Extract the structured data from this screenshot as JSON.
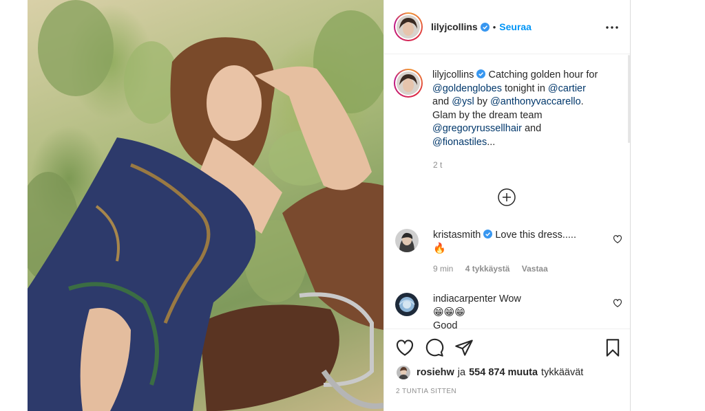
{
  "post": {
    "username": "lilyjcollins",
    "verified": true,
    "follow_separator": "•",
    "follow_label": "Seuraa",
    "more_icon": "more-horizontal-icon",
    "next_icon": "chevron-right-icon"
  },
  "caption": {
    "username": "lilyjcollins",
    "line1_a": "Catching golden hour for",
    "mention1": "@goldenglobes",
    "line2_b": " tonight in ",
    "mention2": "@cartier",
    "line3_a": "and ",
    "mention3": "@ysl",
    "line3_b": " by ",
    "mention4": "@anthonyvaccarello",
    "line3_c": ".",
    "line4": "Glam by the dream team",
    "mention5": "@gregoryrussellhair",
    "line5_b": " and",
    "mention6": "@fionastiles",
    "line6_b": "...",
    "time_ago": "2 t"
  },
  "comments": [
    {
      "username": "kristasmith",
      "verified": true,
      "text": "Love this dress.....",
      "emoji": "🔥",
      "time": "9 min",
      "likes": "4 tykkäystä",
      "reply": "Vastaa"
    },
    {
      "username": "indiacarpenter",
      "verified": false,
      "text": "Wow",
      "emoji": "😁😁😁",
      "partial_next": "Good"
    }
  ],
  "likes": {
    "user": "rosiehw",
    "connector": "ja",
    "count": "554 874 muuta",
    "suffix": "tykkäävät"
  },
  "timestamp": "2 TUNTIA SITTEN",
  "colors": {
    "accent": "#0095f6",
    "mention": "#00376b",
    "muted": "#8e8e8e",
    "verified": "#3897f0"
  }
}
